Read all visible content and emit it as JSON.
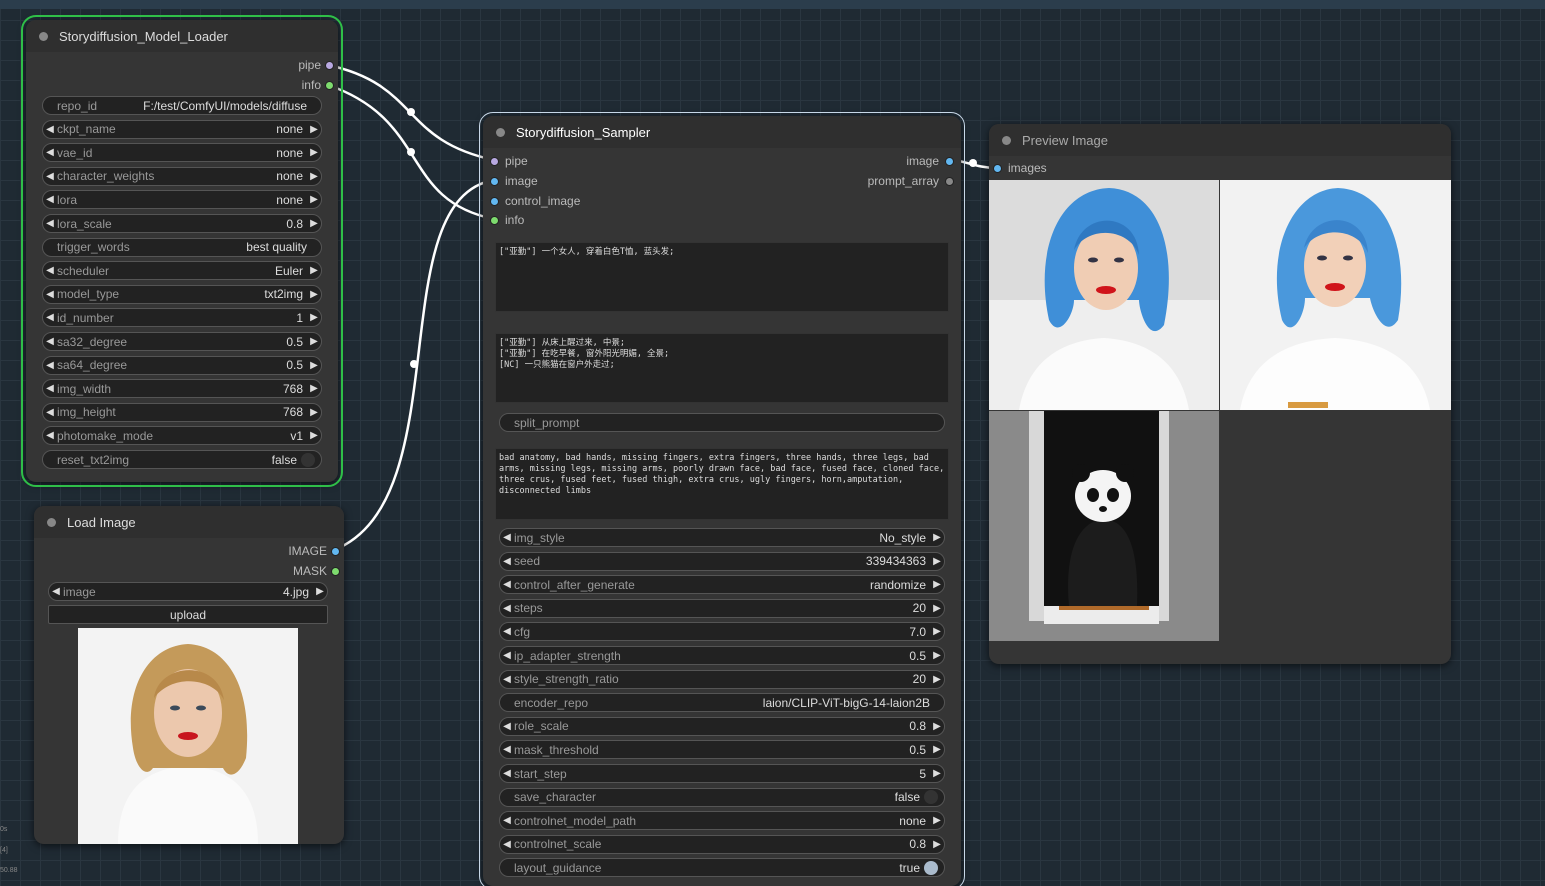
{
  "loader": {
    "title": "Storydiffusion_Model_Loader",
    "outputs": [
      "pipe",
      "info"
    ],
    "widgets": [
      {
        "label": "repo_id",
        "value": "F:/test/ComfyUI/models/diffuse",
        "arrows": false
      },
      {
        "label": "ckpt_name",
        "value": "none",
        "arrows": true
      },
      {
        "label": "vae_id",
        "value": "none",
        "arrows": true
      },
      {
        "label": "character_weights",
        "value": "none",
        "arrows": true
      },
      {
        "label": "lora",
        "value": "none",
        "arrows": true
      },
      {
        "label": "lora_scale",
        "value": "0.8",
        "arrows": true
      },
      {
        "label": "trigger_words",
        "value": "best quality",
        "arrows": false
      },
      {
        "label": "scheduler",
        "value": "Euler",
        "arrows": true
      },
      {
        "label": "model_type",
        "value": "txt2img",
        "arrows": true
      },
      {
        "label": "id_number",
        "value": "1",
        "arrows": true
      },
      {
        "label": "sa32_degree",
        "value": "0.5",
        "arrows": true
      },
      {
        "label": "sa64_degree",
        "value": "0.5",
        "arrows": true
      },
      {
        "label": "img_width",
        "value": "768",
        "arrows": true
      },
      {
        "label": "img_height",
        "value": "768",
        "arrows": true
      },
      {
        "label": "photomake_mode",
        "value": "v1",
        "arrows": true
      },
      {
        "label": "reset_txt2img",
        "value": "false",
        "toggle": true
      }
    ]
  },
  "load_image": {
    "title": "Load Image",
    "outputs": [
      "IMAGE",
      "MASK"
    ],
    "image_widget": {
      "label": "image",
      "value": "4.jpg"
    },
    "upload_label": "upload"
  },
  "sampler": {
    "title": "Storydiffusion_Sampler",
    "inputs": [
      "pipe",
      "image",
      "control_image",
      "info"
    ],
    "outputs": [
      "image",
      "prompt_array"
    ],
    "character_prompt": "[\"亚勤\"] 一个女人, 穿着白色T恤, 蓝头发;",
    "scene_prompts": "[\"亚勤\"] 从床上醒过来, 中景;\n[\"亚勤\"] 在吃早餐, 窗外阳光明媚, 全景;\n[NC] 一只熊猫在窗户外走过;",
    "split_prompt_label": "split_prompt",
    "negative_prompt": "bad anatomy, bad hands, missing fingers, extra fingers, three hands, three legs, bad arms, missing legs, missing arms, poorly drawn face, bad face, fused face, cloned face, three crus, fused feet, fused thigh, extra crus, ugly fingers, horn,amputation, disconnected limbs",
    "widgets": [
      {
        "label": "img_style",
        "value": "No_style",
        "arrows": true
      },
      {
        "label": "seed",
        "value": "339434363",
        "arrows": true
      },
      {
        "label": "control_after_generate",
        "value": "randomize",
        "arrows": true
      },
      {
        "label": "steps",
        "value": "20",
        "arrows": true
      },
      {
        "label": "cfg",
        "value": "7.0",
        "arrows": true
      },
      {
        "label": "ip_adapter_strength",
        "value": "0.5",
        "arrows": true
      },
      {
        "label": "style_strength_ratio",
        "value": "20",
        "arrows": true
      },
      {
        "label": "encoder_repo",
        "value": "laion/CLIP-ViT-bigG-14-laion2B",
        "arrows": false
      },
      {
        "label": "role_scale",
        "value": "0.8",
        "arrows": true
      },
      {
        "label": "mask_threshold",
        "value": "0.5",
        "arrows": true
      },
      {
        "label": "start_step",
        "value": "5",
        "arrows": true
      },
      {
        "label": "save_character",
        "value": "false",
        "toggle": true
      },
      {
        "label": "controlnet_model_path",
        "value": "none",
        "arrows": true
      },
      {
        "label": "controlnet_scale",
        "value": "0.8",
        "arrows": true
      },
      {
        "label": "layout_guidance",
        "value": "true",
        "toggle": true,
        "on": true
      }
    ]
  },
  "preview": {
    "title": "Preview Image",
    "input": "images"
  },
  "side_labels": [
    "0s",
    "[4]",
    "50.88"
  ],
  "icons": {
    "arrow_left": "◀",
    "arrow_right": "▶"
  }
}
